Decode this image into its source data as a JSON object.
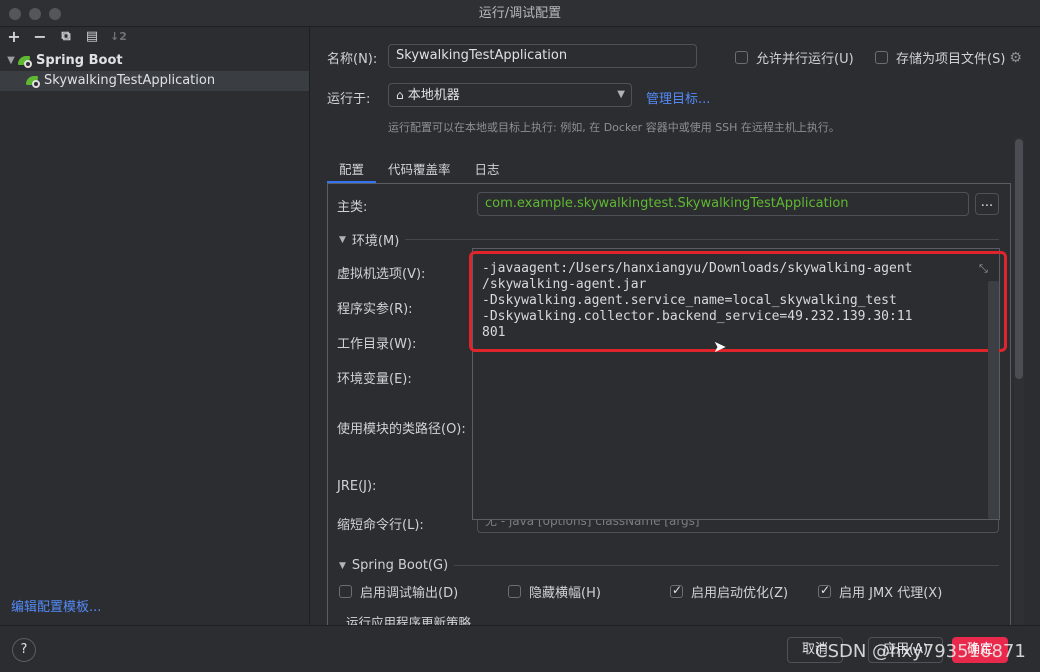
{
  "window": {
    "title": "运行/调试配置"
  },
  "toolbar": {
    "add": "+",
    "remove": "−",
    "copy": "⧉",
    "folder": "▤",
    "sort": "↓2"
  },
  "tree": {
    "group_label": "Spring Boot",
    "item_label": "SkywalkingTestApplication"
  },
  "left_footer": {
    "edit_templates": "编辑配置模板..."
  },
  "form": {
    "name_label": "名称(N):",
    "name_value": "SkywalkingTestApplication",
    "allow_parallel": "允许并行运行(U)",
    "store_as_file": "存储为项目文件(S)",
    "run_on_label": "运行于:",
    "run_on_value": "本地机器",
    "manage_targets": "管理目标...",
    "run_on_hint": "运行配置可以在本地或目标上执行: 例如, 在 Docker 容器中或使用 SSH 在远程主机上执行。"
  },
  "tabs": [
    "配置",
    "代码覆盖率",
    "日志"
  ],
  "config": {
    "main_class_label": "主类:",
    "main_class_value": "com.example.skywalkingtest.SkywalkingTestApplication",
    "dots": "...",
    "env_section": "环境(M)",
    "vm_options_label": "虚拟机选项(V):",
    "program_args_label": "程序实参(R):",
    "working_dir_label": "工作目录(W):",
    "env_vars_label": "环境变量(E):",
    "module_classpath_label": "使用模块的类路径(O):",
    "jre_label": "JRE(J):",
    "shorten_cmd_label": "缩短命令行(L):",
    "shorten_cmd_value": "无 - java [options] className [args]",
    "vm_options_value": "-javaagent:/Users/hanxiangyu/Downloads/skywalking-agent\n/skywalking-agent.jar\n-Dskywalking.agent.service_name=local_skywalking_test\n-Dskywalking.collector.backend_service=49.232.139.30:11\n801",
    "springboot_section": "Spring Boot(G)",
    "enable_debug": "启用调试输出(D)",
    "hide_banner": "隐藏横幅(H)",
    "enable_launch_opt": "启用启动优化(Z)",
    "enable_jmx": "启用 JMX 代理(X)",
    "update_policy": "运行应用程序更新策略"
  },
  "buttons": {
    "help": "?",
    "cancel": "取消",
    "apply": "应用(A)",
    "ok": "确定"
  },
  "watermark": "CSDN @hxy793516871"
}
